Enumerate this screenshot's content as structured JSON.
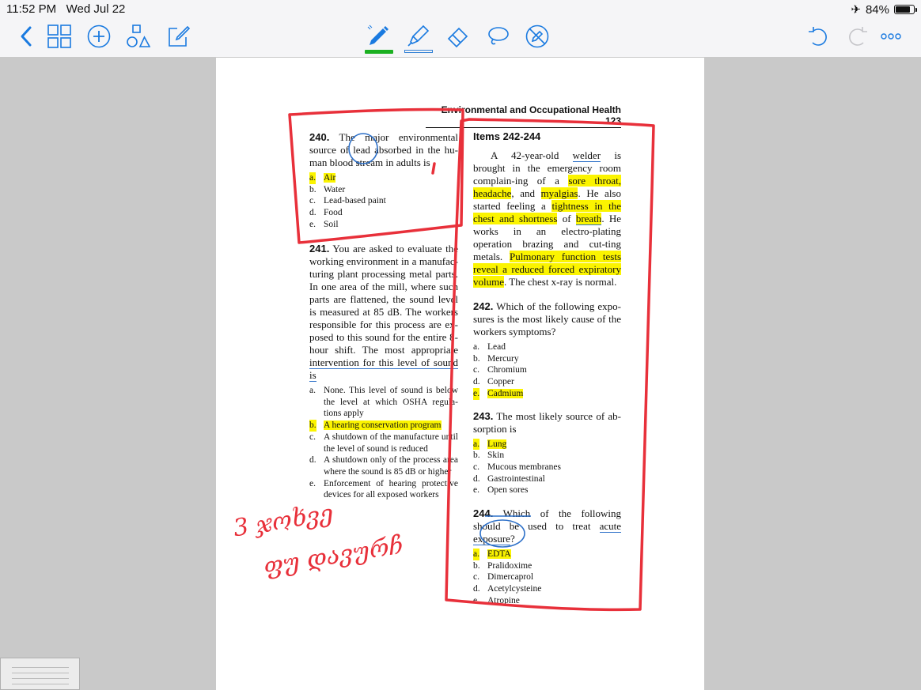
{
  "status_bar": {
    "time": "11:52 PM",
    "date": "Wed Jul 22",
    "battery": "84%",
    "battery_level": 0.84
  },
  "toolbar": {
    "left": [
      "back-icon",
      "grid-icon",
      "add-icon",
      "shapes-icon",
      "edit-icon"
    ],
    "tools": [
      "pen-icon",
      "highlighter-icon",
      "eraser-icon",
      "lasso-icon",
      "no-touch-icon"
    ],
    "right": [
      "undo-icon",
      "redo-icon",
      "more-icon"
    ],
    "colors": {
      "accent": "#1a7ae0",
      "pen": "#1bb021",
      "ink": "#e8303a",
      "highlight": "#fbf400"
    }
  },
  "document": {
    "header": "Environmental and Occupational Health   123",
    "q240": {
      "num": "240.",
      "text_a": "The major environmental source of lead absorbed in the hu-",
      "text_b": "man blood stream in adults is",
      "options": [
        {
          "letter": "a.",
          "text": "Air",
          "highlighted": true
        },
        {
          "letter": "b.",
          "text": "Water"
        },
        {
          "letter": "c.",
          "text": "Lead-based paint"
        },
        {
          "letter": "d.",
          "text": "Food"
        },
        {
          "letter": "e.",
          "text": "Soil"
        }
      ]
    },
    "q241": {
      "num": "241.",
      "text": "You are asked to evaluate the working environment in a manufac-turing plant processing metal parts. In one area of the mill, where such parts are flattened, the sound level is measured at 85 dB. The workers responsible for this process are ex-posed to this sound for the entire 8-hour shift. The most appropriate",
      "text_underlined": "intervention for this level of sound is",
      "options": [
        {
          "letter": "a.",
          "text": "None. This level of sound is below the level at which OSHA regula-tions apply"
        },
        {
          "letter": "b.",
          "text": "A hearing conservation program",
          "highlighted": true
        },
        {
          "letter": "c.",
          "text": "A shutdown of the manufacture until the level of sound is reduced"
        },
        {
          "letter": "d.",
          "text": "A shutdown only of the process area where the sound is 85 dB or higher"
        },
        {
          "letter": "e.",
          "text": "Enforcement of hearing protective devices for all exposed workers"
        }
      ]
    },
    "items": {
      "heading": "Items 242-244",
      "p1": "A 42-year-old",
      "welder": "welder",
      "p2": "is brought in the emergency room complain-ing of a",
      "hl1": "sore throat, headache",
      "p3": ", and",
      "hl2": "myalgias",
      "p4": ". He also started feeling a",
      "hl3": "tightness in the chest and shortness",
      "p5": "of",
      "hl4": "breath",
      "p6": ". He works in an electro-plating operation brazing and cut-ting metals.",
      "hl5": "Pulmonary function tests reveal a reduced forced expiratory volume",
      "p7": ". The chest x-ray is normal."
    },
    "q242": {
      "num": "242.",
      "text": "Which of the following expo-sures is the most likely cause of the workers symptoms?",
      "options": [
        {
          "letter": "a.",
          "text": "Lead"
        },
        {
          "letter": "b.",
          "text": "Mercury"
        },
        {
          "letter": "c.",
          "text": "Chromium"
        },
        {
          "letter": "d.",
          "text": "Copper"
        },
        {
          "letter": "e.",
          "text": "Cadmium",
          "highlighted": true
        }
      ]
    },
    "q243": {
      "num": "243.",
      "text": "The most likely source of ab-sorption is",
      "options": [
        {
          "letter": "a.",
          "text": "Lung",
          "highlighted": true
        },
        {
          "letter": "b.",
          "text": "Skin"
        },
        {
          "letter": "c.",
          "text": "Mucous membranes"
        },
        {
          "letter": "d.",
          "text": "Gastrointestinal"
        },
        {
          "letter": "e.",
          "text": "Open sores"
        }
      ]
    },
    "q244": {
      "num": "244.",
      "text_a": "Which of the following should be used to treat",
      "text_ul": "acute exposure",
      "text_b": "?",
      "options": [
        {
          "letter": "a.",
          "text": "EDTA",
          "highlighted": true
        },
        {
          "letter": "b.",
          "text": "Pralidoxime"
        },
        {
          "letter": "c.",
          "text": "Dimercaprol"
        },
        {
          "letter": "d.",
          "text": "Acetylcysteine"
        },
        {
          "letter": "e.",
          "text": "Atropine"
        }
      ]
    },
    "handwriting": {
      "line1": "3 ჯოხვე",
      "line2": "ფუ დავურჩ"
    }
  }
}
